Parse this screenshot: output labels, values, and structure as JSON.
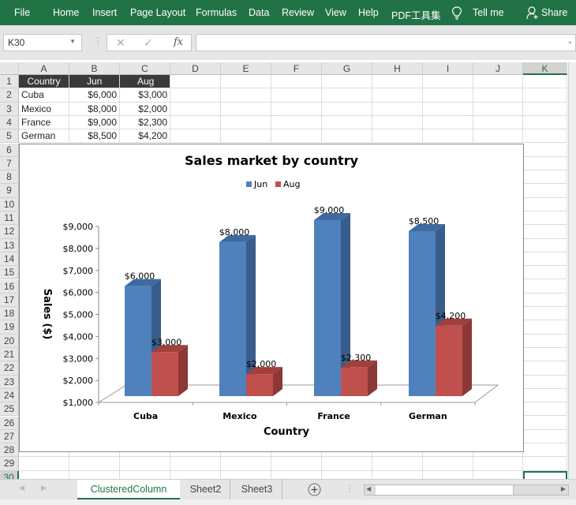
{
  "ribbon": {
    "tabs": [
      "File",
      "Home",
      "Insert",
      "Page Layout",
      "Formulas",
      "Data",
      "Review",
      "View",
      "Help",
      "PDF工具集"
    ],
    "tell_me": "Tell me",
    "share": "Share"
  },
  "formula_bar": {
    "name_box": "K30",
    "cancel_icon": "✕",
    "enter_icon": "✓",
    "fx_label": "fx",
    "formula_value": ""
  },
  "sheet": {
    "columns": [
      "A",
      "B",
      "C",
      "D",
      "E",
      "F",
      "G",
      "H",
      "I",
      "J",
      "K"
    ],
    "rows": [
      "1",
      "2",
      "3",
      "4",
      "5",
      "6",
      "7",
      "8",
      "9",
      "10",
      "11",
      "12",
      "13",
      "14",
      "15",
      "16",
      "17",
      "18",
      "19",
      "20",
      "21",
      "22",
      "23",
      "24",
      "25",
      "26",
      "27",
      "28",
      "29",
      "30"
    ],
    "selected_cell": "K30",
    "table": {
      "headers": [
        "Country",
        "Jun",
        "Aug"
      ],
      "rows": [
        [
          "Cuba",
          "$6,000",
          "$3,000"
        ],
        [
          "Mexico",
          "$8,000",
          "$2,000"
        ],
        [
          "France",
          "$9,000",
          "$2,300"
        ],
        [
          "German",
          "$8,500",
          "$4,200"
        ]
      ]
    }
  },
  "chart_data": {
    "type": "bar",
    "subtype": "3d-clustered-column",
    "title": "Sales market by country",
    "xlabel": "Country",
    "ylabel": "Sales ($)",
    "categories": [
      "Cuba",
      "Mexico",
      "France",
      "German"
    ],
    "series": [
      {
        "name": "Jun",
        "values": [
          6000,
          8000,
          9000,
          8500
        ],
        "labels": [
          "$6,000",
          "$8,000",
          "$9,000",
          "$8,500"
        ],
        "color": "#4f81bd",
        "side_color": "#385d8a",
        "top_color": "#3f6aa0"
      },
      {
        "name": "Aug",
        "values": [
          3000,
          2000,
          2300,
          4200
        ],
        "labels": [
          "$3,000",
          "$2,000",
          "$2,300",
          "$4,200"
        ],
        "color": "#c0504d",
        "side_color": "#8c3836",
        "top_color": "#a23f3c"
      }
    ],
    "ylim": [
      1000,
      9000
    ],
    "yticks": [
      "$1,000",
      "$2,000",
      "$3,000",
      "$4,000",
      "$5,000",
      "$6,000",
      "$7,000",
      "$8,000",
      "$9,000"
    ],
    "ytick_values": [
      1000,
      2000,
      3000,
      4000,
      5000,
      6000,
      7000,
      8000,
      9000
    ],
    "legend": "top",
    "grid": false
  },
  "sheet_tabs": {
    "tabs": [
      "ClusteredColumn",
      "Sheet2",
      "Sheet3"
    ],
    "active": "ClusteredColumn"
  }
}
